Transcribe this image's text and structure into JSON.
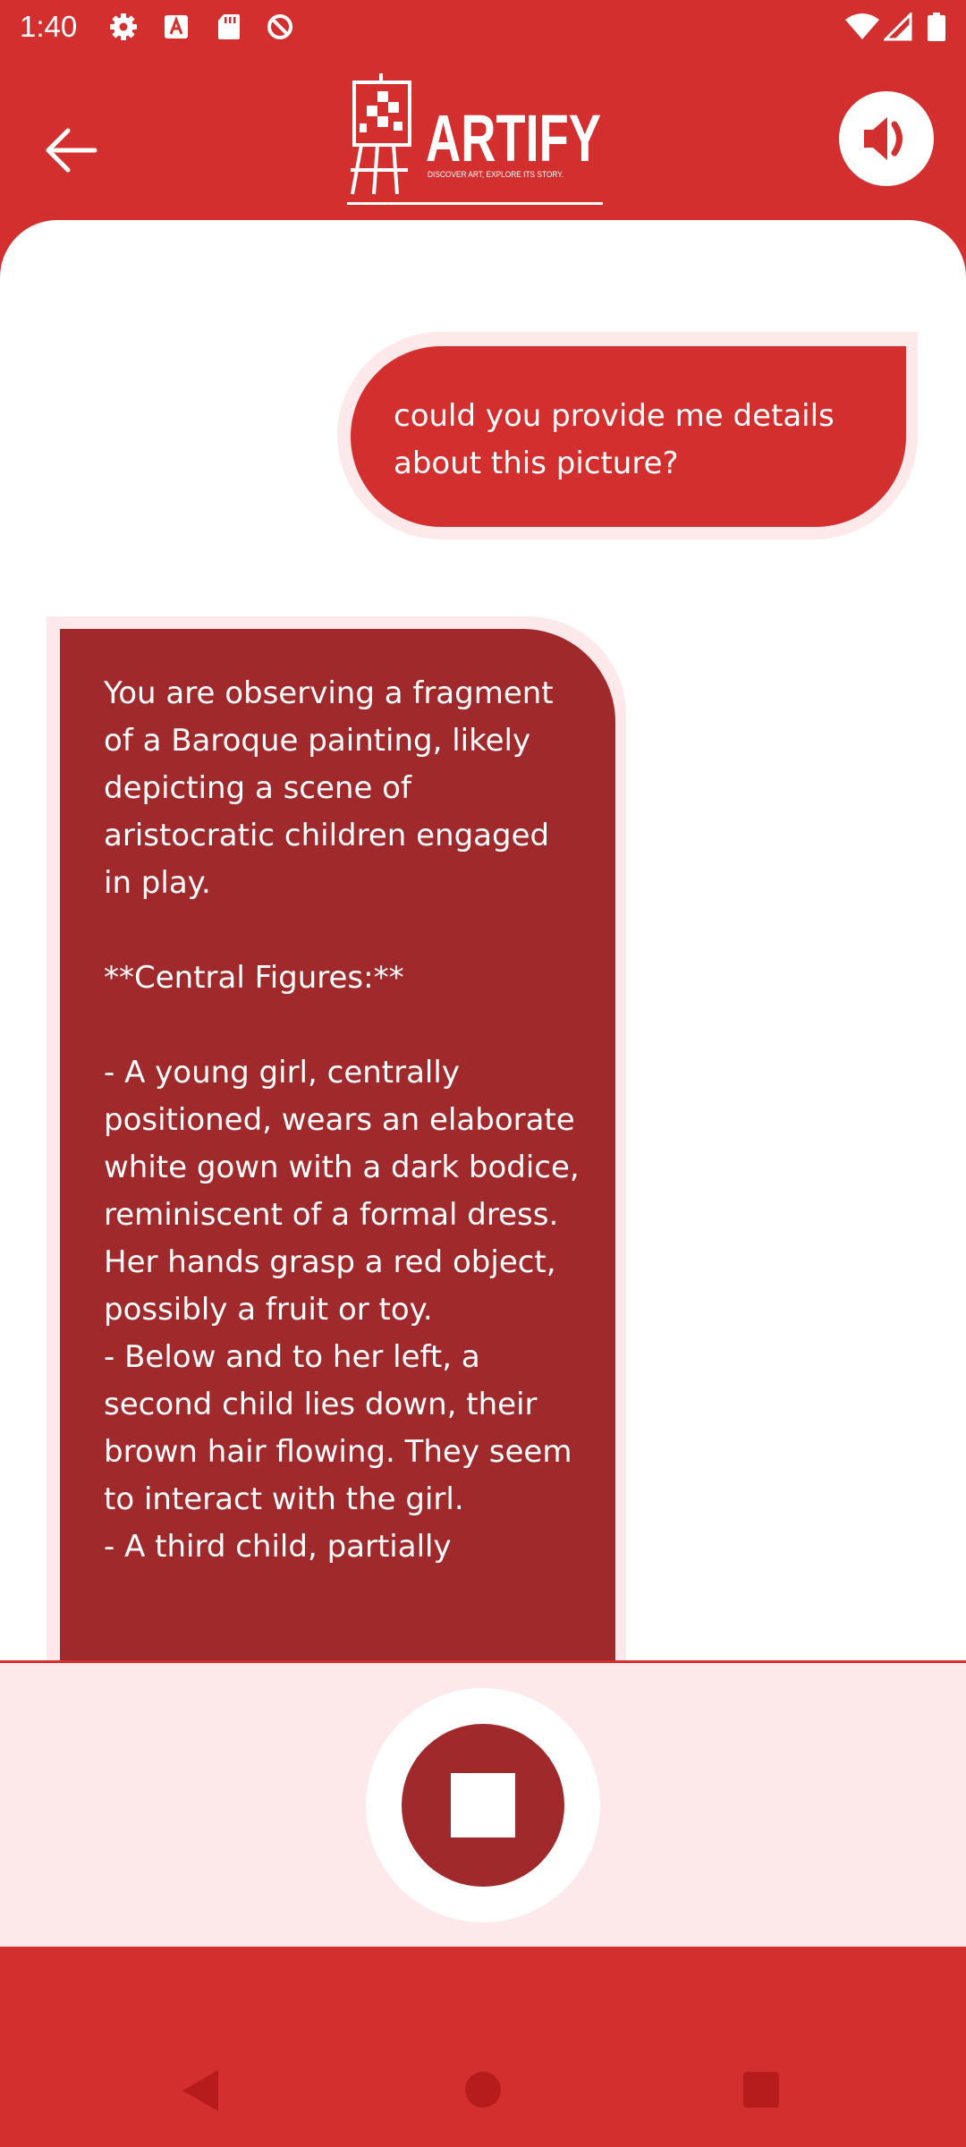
{
  "status_bar": {
    "time": "1:40",
    "icons": [
      "gear-icon",
      "text-a-icon",
      "sd-card-icon",
      "no-entry-icon",
      "wifi-icon",
      "cellular-signal-icon",
      "battery-icon"
    ]
  },
  "header": {
    "back_icon": "arrow-left-icon",
    "logo_name": "ARTIFY",
    "logo_tagline": "DISCOVER ART, EXPLORE ITS STORY.",
    "sound_icon": "volume-icon"
  },
  "chat": {
    "user_message": "could you provide me details about this picture?",
    "ai_message": "You are observing a fragment of a Baroque painting, likely depicting a scene of aristocratic children engaged in play.\n\n**Central Figures:**\n\n- A young girl, centrally positioned, wears an elaborate white gown with a dark bodice, reminiscent of a formal dress. Her hands grasp a red object, possibly a fruit or toy.\n- Below and to her left, a second child lies down, their brown hair flowing. They seem to interact with the girl.\n- A third child, partially"
  },
  "controls": {
    "stop_icon": "stop-icon"
  },
  "colors": {
    "primary_red": "#d32f2f",
    "dark_red": "#a0292c",
    "light_pink": "#fde8ea",
    "white": "#ffffff"
  }
}
